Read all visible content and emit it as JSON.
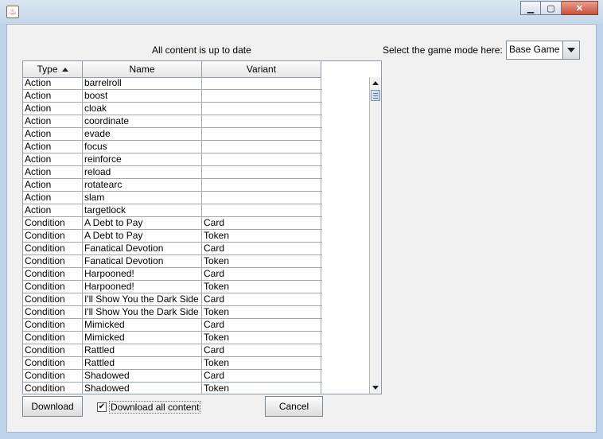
{
  "window": {
    "title": ""
  },
  "status_text": "All content is up to date",
  "game_mode": {
    "label": "Select the game mode here:",
    "selected": "Base Game"
  },
  "table": {
    "columns": [
      "Type",
      "Name",
      "Variant"
    ],
    "rows": [
      [
        "Action",
        "barrelroll",
        ""
      ],
      [
        "Action",
        "boost",
        ""
      ],
      [
        "Action",
        "cloak",
        ""
      ],
      [
        "Action",
        "coordinate",
        ""
      ],
      [
        "Action",
        "evade",
        ""
      ],
      [
        "Action",
        "focus",
        ""
      ],
      [
        "Action",
        "reinforce",
        ""
      ],
      [
        "Action",
        "reload",
        ""
      ],
      [
        "Action",
        "rotatearc",
        ""
      ],
      [
        "Action",
        "slam",
        ""
      ],
      [
        "Action",
        "targetlock",
        ""
      ],
      [
        "Condition",
        "A Debt to Pay",
        "Card"
      ],
      [
        "Condition",
        "A Debt to Pay",
        "Token"
      ],
      [
        "Condition",
        "Fanatical Devotion",
        "Card"
      ],
      [
        "Condition",
        "Fanatical Devotion",
        "Token"
      ],
      [
        "Condition",
        "Harpooned!",
        "Card"
      ],
      [
        "Condition",
        "Harpooned!",
        "Token"
      ],
      [
        "Condition",
        "I'll Show You the Dark Side",
        "Card"
      ],
      [
        "Condition",
        "I'll Show You the Dark Side",
        "Token"
      ],
      [
        "Condition",
        "Mimicked",
        "Card"
      ],
      [
        "Condition",
        "Mimicked",
        "Token"
      ],
      [
        "Condition",
        "Rattled",
        "Card"
      ],
      [
        "Condition",
        "Rattled",
        "Token"
      ],
      [
        "Condition",
        "Shadowed",
        "Card"
      ],
      [
        "Condition",
        "Shadowed",
        "Token"
      ]
    ]
  },
  "buttons": {
    "download": "Download",
    "cancel": "Cancel"
  },
  "checkbox": {
    "label": "Download all content",
    "checked": true
  }
}
